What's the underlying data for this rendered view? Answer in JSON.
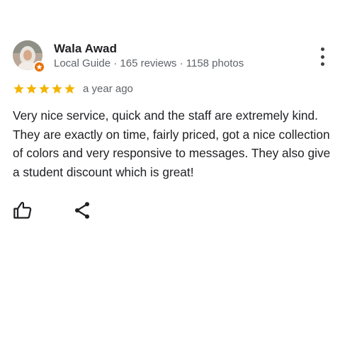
{
  "review": {
    "author": "Wala Awad",
    "meta": "Local Guide · 165 reviews · 1158 photos",
    "rating": 5,
    "rating_max": 5,
    "time": "a year ago",
    "text": "Very nice service, quick and the staff are extremely kind. They are exactly on time, fairly priced, got a nice collection of colors and very responsive to messages. They also give a student discount which is great!"
  },
  "icons": {
    "avatar": "avatar",
    "badge": "local-guide-badge-icon",
    "more": "more-vert-icon",
    "star": "star-icon",
    "like": "thumb-up-icon",
    "share": "share-icon"
  },
  "colors": {
    "star": "#f4b400",
    "badge": "#e8710a",
    "text": "#202124",
    "secondary": "#5f6368"
  }
}
